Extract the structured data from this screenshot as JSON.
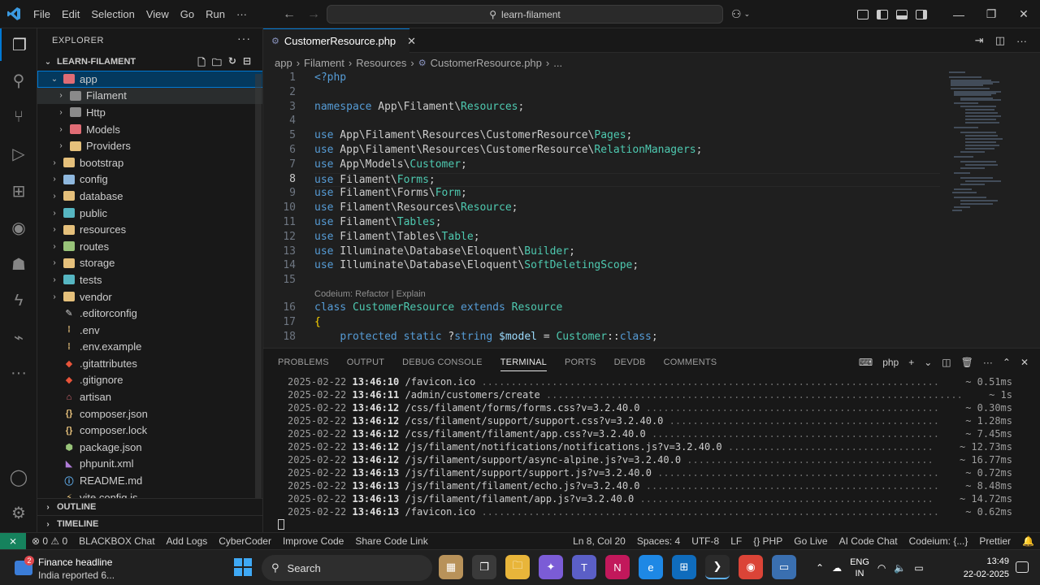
{
  "titlebar": {
    "menu": [
      "File",
      "Edit",
      "Selection",
      "View",
      "Go",
      "Run",
      "···"
    ],
    "search_text": "learn-filament"
  },
  "explorer": {
    "title": "EXPLORER",
    "project": "LEARN-FILAMENT",
    "tree": [
      {
        "name": "app",
        "type": "folder",
        "depth": 0,
        "open": true,
        "color": "#e06c75",
        "selected": true
      },
      {
        "name": "Filament",
        "type": "folder",
        "depth": 1,
        "open": false,
        "color": "#8a8a8a",
        "hover": true
      },
      {
        "name": "Http",
        "type": "folder",
        "depth": 1,
        "open": false,
        "color": "#8a8a8a"
      },
      {
        "name": "Models",
        "type": "folder",
        "depth": 1,
        "open": false,
        "color": "#e06c75"
      },
      {
        "name": "Providers",
        "type": "folder",
        "depth": 1,
        "open": false,
        "color": "#e5c07b"
      },
      {
        "name": "bootstrap",
        "type": "folder",
        "depth": 0,
        "open": false,
        "color": "#e5c07b"
      },
      {
        "name": "config",
        "type": "folder",
        "depth": 0,
        "open": false,
        "color": "#8fb8de"
      },
      {
        "name": "database",
        "type": "folder",
        "depth": 0,
        "open": false,
        "color": "#e5c07b"
      },
      {
        "name": "public",
        "type": "folder",
        "depth": 0,
        "open": false,
        "color": "#56b6c2"
      },
      {
        "name": "resources",
        "type": "folder",
        "depth": 0,
        "open": false,
        "color": "#e5c07b"
      },
      {
        "name": "routes",
        "type": "folder",
        "depth": 0,
        "open": false,
        "color": "#98c379"
      },
      {
        "name": "storage",
        "type": "folder",
        "depth": 0,
        "open": false,
        "color": "#e5c07b"
      },
      {
        "name": "tests",
        "type": "folder",
        "depth": 0,
        "open": false,
        "color": "#56b6c2"
      },
      {
        "name": "vendor",
        "type": "folder",
        "depth": 0,
        "open": false,
        "color": "#e5c07b"
      },
      {
        "name": ".editorconfig",
        "type": "file",
        "depth": 0,
        "glyph": "✎",
        "color": "#d0d0d0"
      },
      {
        "name": ".env",
        "type": "file",
        "depth": 0,
        "glyph": "⁞",
        "color": "#e5c07b"
      },
      {
        "name": ".env.example",
        "type": "file",
        "depth": 0,
        "glyph": "⁞",
        "color": "#e5c07b"
      },
      {
        "name": ".gitattributes",
        "type": "file",
        "depth": 0,
        "glyph": "◆",
        "color": "#e8543a"
      },
      {
        "name": ".gitignore",
        "type": "file",
        "depth": 0,
        "glyph": "◆",
        "color": "#e8543a"
      },
      {
        "name": "artisan",
        "type": "file",
        "depth": 0,
        "glyph": "⌂",
        "color": "#e06c75"
      },
      {
        "name": "composer.json",
        "type": "file",
        "depth": 0,
        "glyph": "{}",
        "color": "#e5c07b"
      },
      {
        "name": "composer.lock",
        "type": "file",
        "depth": 0,
        "glyph": "{}",
        "color": "#e5c07b"
      },
      {
        "name": "package.json",
        "type": "file",
        "depth": 0,
        "glyph": "⬢",
        "color": "#98c379"
      },
      {
        "name": "phpunit.xml",
        "type": "file",
        "depth": 0,
        "glyph": "◣",
        "color": "#b07cd8"
      },
      {
        "name": "README.md",
        "type": "file",
        "depth": 0,
        "glyph": "ⓘ",
        "color": "#61afef"
      },
      {
        "name": "vite.config.js",
        "type": "file",
        "depth": 0,
        "glyph": "⚡",
        "color": "#e5c07b"
      }
    ],
    "outline": "OUTLINE",
    "timeline": "TIMELINE"
  },
  "editor": {
    "tab": "CustomerResource.php",
    "breadcrumb": [
      "app",
      "Filament",
      "Resources",
      "CustomerResource.php",
      "..."
    ],
    "lines": [
      {
        "n": "1",
        "text": "<?php"
      },
      {
        "n": "2",
        "text": ""
      },
      {
        "n": "3",
        "text": "namespace App\\Filament\\Resources;"
      },
      {
        "n": "4",
        "text": ""
      },
      {
        "n": "5",
        "text": "use App\\Filament\\Resources\\CustomerResource\\Pages;"
      },
      {
        "n": "6",
        "text": "use App\\Filament\\Resources\\CustomerResource\\RelationManagers;"
      },
      {
        "n": "7",
        "text": "use App\\Models\\Customer;"
      },
      {
        "n": "8",
        "text": "use Filament\\Forms;"
      },
      {
        "n": "9",
        "text": "use Filament\\Forms\\Form;"
      },
      {
        "n": "10",
        "text": "use Filament\\Resources\\Resource;"
      },
      {
        "n": "11",
        "text": "use Filament\\Tables;"
      },
      {
        "n": "12",
        "text": "use Filament\\Tables\\Table;"
      },
      {
        "n": "13",
        "text": "use Illuminate\\Database\\Eloquent\\Builder;"
      },
      {
        "n": "14",
        "text": "use Illuminate\\Database\\Eloquent\\SoftDeletingScope;"
      },
      {
        "n": "15",
        "text": ""
      },
      {
        "n": "16",
        "text": "class CustomerResource extends Resource"
      },
      {
        "n": "17",
        "text": "{"
      },
      {
        "n": "18",
        "text": "    protected static ?string $model = Customer::class;"
      }
    ],
    "codelens": "Codeium: Refactor | Explain",
    "current_line": "8"
  },
  "panel": {
    "tabs": [
      "PROBLEMS",
      "OUTPUT",
      "DEBUG CONSOLE",
      "TERMINAL",
      "PORTS",
      "DEVDB",
      "COMMENTS"
    ],
    "active_tab": "TERMINAL",
    "shell": "php",
    "terminal": [
      {
        "date": "2025-02-22",
        "time": "13:46:10",
        "path": "/favicon.ico",
        "ms": "~ 0.51ms"
      },
      {
        "date": "2025-02-22",
        "time": "13:46:11",
        "path": "/admin/customers/create",
        "ms": "~ 1s"
      },
      {
        "date": "2025-02-22",
        "time": "13:46:12",
        "path": "/css/filament/forms/forms.css?v=3.2.40.0",
        "ms": "~ 0.30ms"
      },
      {
        "date": "2025-02-22",
        "time": "13:46:12",
        "path": "/css/filament/support/support.css?v=3.2.40.0",
        "ms": "~ 1.28ms"
      },
      {
        "date": "2025-02-22",
        "time": "13:46:12",
        "path": "/css/filament/filament/app.css?v=3.2.40.0",
        "ms": "~ 7.45ms"
      },
      {
        "date": "2025-02-22",
        "time": "13:46:12",
        "path": "/js/filament/notifications/notifications.js?v=3.2.40.0",
        "ms": "~ 12.73ms"
      },
      {
        "date": "2025-02-22",
        "time": "13:46:12",
        "path": "/js/filament/support/async-alpine.js?v=3.2.40.0",
        "ms": "~ 16.77ms"
      },
      {
        "date": "2025-02-22",
        "time": "13:46:13",
        "path": "/js/filament/support/support.js?v=3.2.40.0",
        "ms": "~ 0.72ms"
      },
      {
        "date": "2025-02-22",
        "time": "13:46:13",
        "path": "/js/filament/filament/echo.js?v=3.2.40.0",
        "ms": "~ 8.48ms"
      },
      {
        "date": "2025-02-22",
        "time": "13:46:13",
        "path": "/js/filament/filament/app.js?v=3.2.40.0",
        "ms": "~ 14.72ms"
      },
      {
        "date": "2025-02-22",
        "time": "13:46:13",
        "path": "/favicon.ico",
        "ms": "~ 0.62ms"
      }
    ]
  },
  "statusbar": {
    "left": [
      "⊗ 0 ⚠ 0",
      "BLACKBOX Chat",
      "Add Logs",
      "CyberCoder",
      "Improve Code",
      "Share Code Link"
    ],
    "right": [
      "Ln 8, Col 20",
      "Spaces: 4",
      "UTF-8",
      "LF",
      "{} PHP",
      "Go Live",
      "AI Code Chat",
      "Codeium: {...}",
      "Prettier"
    ]
  },
  "taskbar": {
    "news_title": "Finance headline",
    "news_sub": "India reported 6...",
    "news_badge": "2",
    "search": "Search",
    "lang1": "ENG",
    "lang2": "IN",
    "time": "13:49",
    "date": "22-02-2025"
  },
  "colors": {
    "accent": "#0078d4",
    "selection": "#04395e",
    "remote": "#16825d"
  }
}
